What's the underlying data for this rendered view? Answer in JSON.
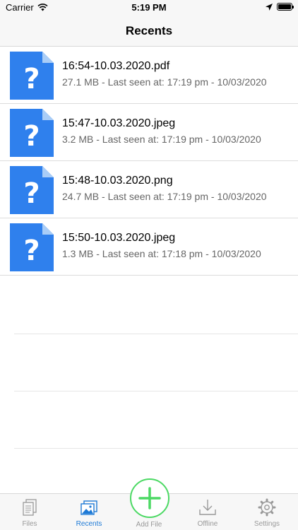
{
  "status_bar": {
    "carrier": "Carrier",
    "time": "5:19 PM"
  },
  "nav": {
    "title": "Recents"
  },
  "files": [
    {
      "name": "16:54-10.03.2020.pdf",
      "meta": "27.1 MB - Last seen at: 17:19 pm - 10/03/2020"
    },
    {
      "name": "15:47-10.03.2020.jpeg",
      "meta": "3.2 MB - Last seen at: 17:19 pm - 10/03/2020"
    },
    {
      "name": "15:48-10.03.2020.png",
      "meta": "24.7 MB - Last seen at: 17:19 pm - 10/03/2020"
    },
    {
      "name": "15:50-10.03.2020.jpeg",
      "meta": "1.3 MB - Last seen at: 17:18 pm - 10/03/2020"
    }
  ],
  "tabs": {
    "files": "Files",
    "recents": "Recents",
    "add_file": "Add File",
    "offline": "Offline",
    "settings": "Settings"
  },
  "colors": {
    "accent": "#1e7ad6",
    "file_icon": "#2f80ed",
    "add_button": "#4cd964"
  }
}
